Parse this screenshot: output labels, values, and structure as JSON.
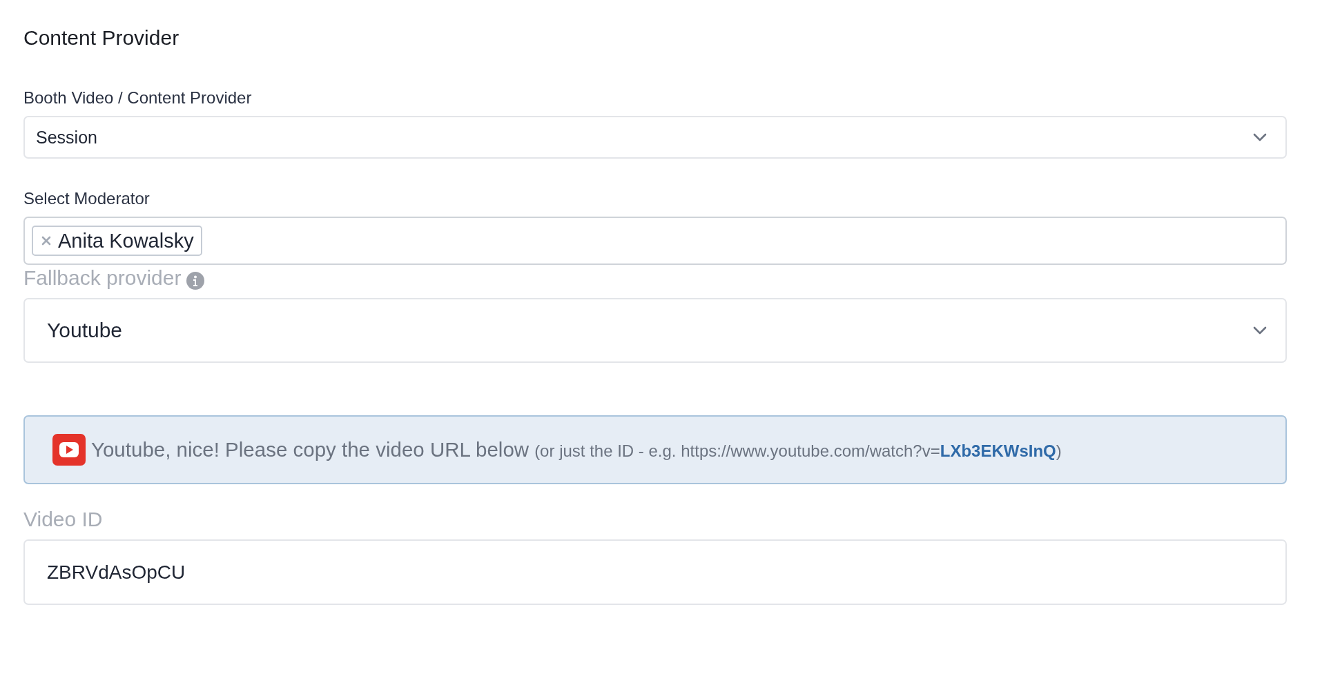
{
  "section_title": "Content Provider",
  "fields": [
    {
      "kind": "select",
      "label": "Booth Video / Content Provider",
      "value": "Session"
    },
    {
      "kind": "tags",
      "label": "Select Moderator",
      "tags": [
        "Anita Kowalsky"
      ]
    },
    {
      "kind": "large-select",
      "label": "Fallback provider",
      "value": "Youtube"
    },
    {
      "kind": "alert",
      "message": "Youtube, nice! Please copy the video URL below",
      "hint": "(or just the ID - e.g. https://www.youtube.com/watch?v=**LXb3EKWsInQ**)"
    },
    {
      "kind": "large-input",
      "label": "Video ID",
      "value": "ZBRVdAsOpCU"
    }
  ]
}
